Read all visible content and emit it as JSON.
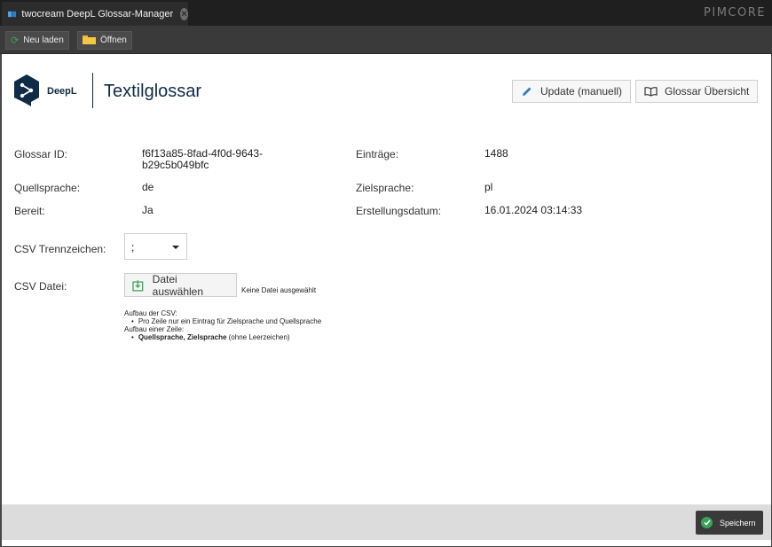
{
  "tab": {
    "title": "twocream DeepL Glossar-Manager",
    "close": "×"
  },
  "brand": "PIMCORE",
  "toolbar": {
    "reload_label": "Neu laden",
    "open_label": "Öffnen"
  },
  "header": {
    "logo_text": "DeepL",
    "title": "Textilglossar",
    "update_button": "Update (manuell)",
    "overview_button": "Glossar Übersicht"
  },
  "info": {
    "glossary_id_label": "Glossar ID:",
    "glossary_id_value_1": "f6f13a85-8fad-4f0d-9643-",
    "glossary_id_value_2": "b29c5b049bfc",
    "entries_label": "Einträge:",
    "entries_value": "1488",
    "source_label": "Quellsprache:",
    "source_value": "de",
    "target_label": "Zielsprache:",
    "target_value": "pl",
    "ready_label": "Bereit:",
    "ready_value": "Ja",
    "created_label": "Erstellungsdatum:",
    "created_value": "16.01.2024 03:14:33"
  },
  "csv": {
    "separator_label": "CSV Trennzeichen:",
    "separator_value": ";",
    "file_label": "CSV Datei:",
    "file_button": "Datei auswählen",
    "no_file": "Keine Datei ausgewählt",
    "help_title": "Aufbau der CSV:",
    "help_item_1": "Pro Zeile nur ein Eintrag für Zielsprache und Quellsprache",
    "help_subtitle": "Aufbau einer Zeile:",
    "help_item_2_bold": "Quellsprache, Zielsprache",
    "help_item_2_rest": " (ohne Leerzeichen)"
  },
  "footer": {
    "save_label": "Speichern"
  },
  "colors": {
    "deepl_navy": "#0f2b46",
    "save_green": "#3aa35a",
    "pimcore_dark": "#1f1f1f"
  },
  "icons": [
    "book-icon",
    "close-icon",
    "refresh-icon",
    "folder-icon",
    "deepl-logo",
    "pencil-icon",
    "open-book-icon",
    "upload-icon",
    "chevron-down-icon",
    "check-icon"
  ]
}
